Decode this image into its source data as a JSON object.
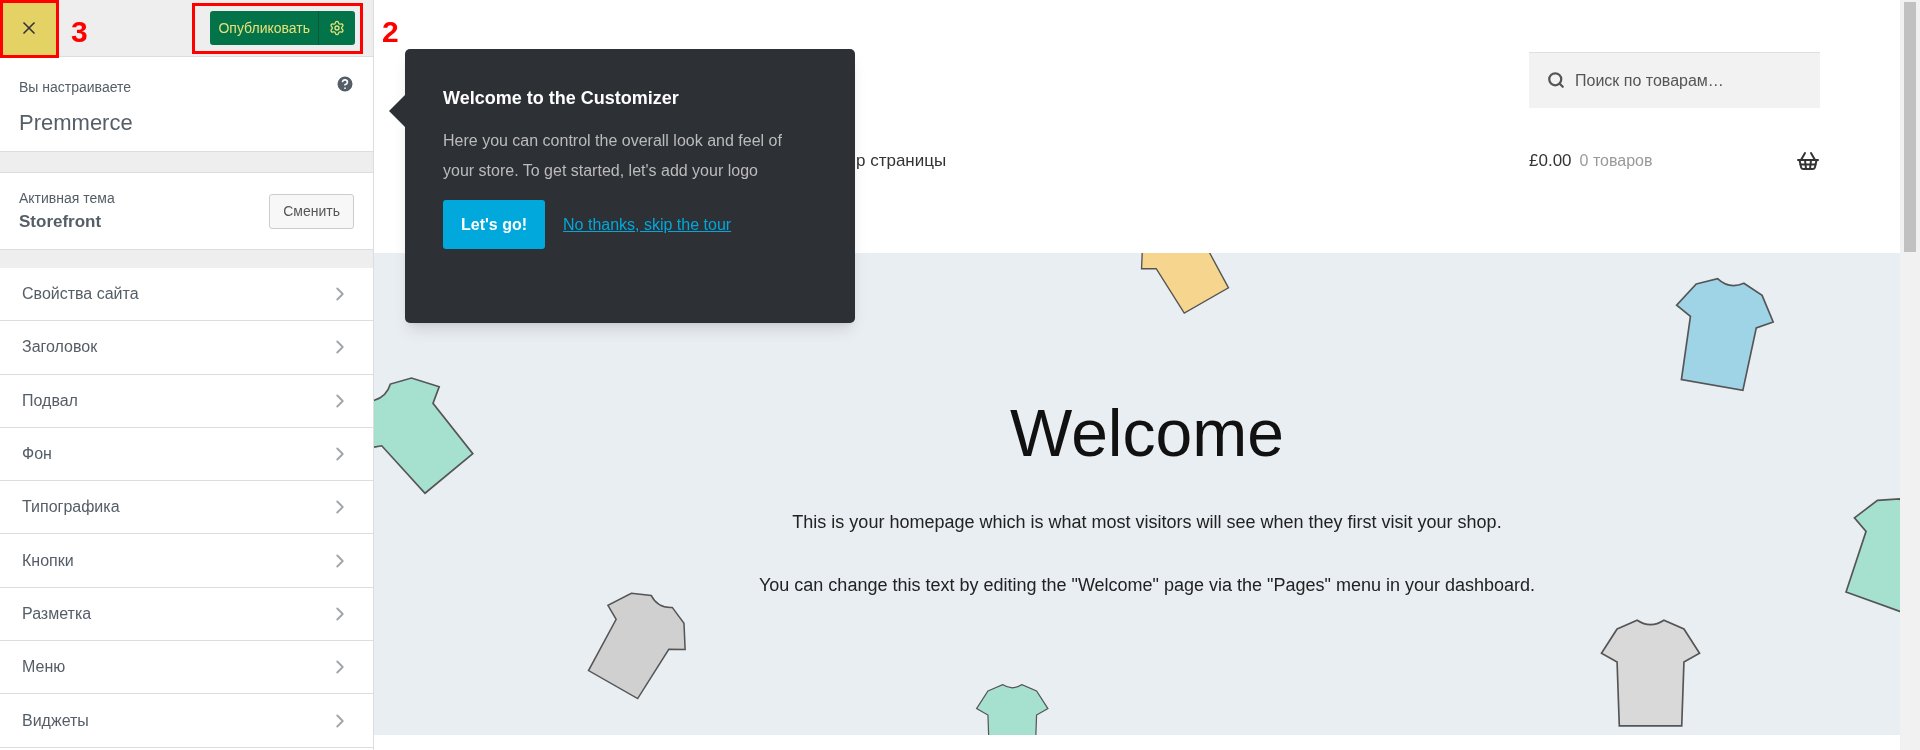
{
  "annotations": [
    {
      "label": "3"
    },
    {
      "label": "2"
    }
  ],
  "header": {
    "publish_label": "Опубликовать"
  },
  "customizing": {
    "caption": "Вы настраиваете",
    "site": "Premmerce"
  },
  "theme": {
    "caption": "Активная тема",
    "name": "Storefront",
    "change_label": "Сменить"
  },
  "sections": [
    "Свойства сайта",
    "Заголовок",
    "Подвал",
    "Фон",
    "Типографика",
    "Кнопки",
    "Разметка",
    "Меню",
    "Виджеты"
  ],
  "preview": {
    "search": {
      "placeholder": "Поиск по товарам…"
    },
    "nav": [
      "р страницы"
    ],
    "cart": {
      "total": "£0.00",
      "count": "0 товаров"
    },
    "hero": {
      "heading": "Welcome",
      "paragraphs": [
        "This is your homepage which is what most visitors will see when they first visit your shop.",
        "You can change this text by editing the \"Welcome\" page via the \"Pages\" menu in your dashboard."
      ]
    }
  },
  "tour": {
    "title": "Welcome to the Customizer",
    "body": "Here you can control the overall look and feel of your store. To get started, let's add your logo",
    "primary": "Let's go!",
    "link": "No thanks, skip the tour"
  }
}
